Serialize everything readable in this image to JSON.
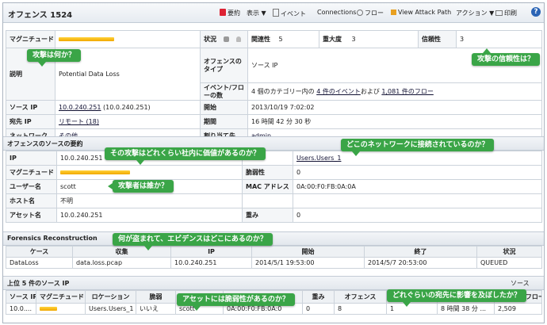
{
  "header": {
    "title": "オフェンス 1524",
    "toolbar": {
      "summary": "要約",
      "display": "表示 ▼",
      "events": "イベント",
      "connections": "Connections",
      "flows": "フロー",
      "attack_path": "View Attack Path",
      "actions": "アクション ▼",
      "print": "印刷",
      "help": "?"
    }
  },
  "offense": {
    "magnitude_label": "マグニチュード",
    "status_label": "状況",
    "relevance_label": "関連性",
    "relevance_value": "5",
    "severity_label": "重大度",
    "severity_value": "3",
    "credibility_label": "信頼性",
    "credibility_value": "3",
    "description_label": "説明",
    "description_value": "Potential Data Loss",
    "offense_type_label": "オフェンスのタイプ",
    "offense_type_value": "ソース IP",
    "event_flow_label": "イベント/フローの数",
    "event_flow_prefix": "4 個のカテゴリー内の ",
    "event_flow_events": "4 件のイベント",
    "event_flow_mid": "および ",
    "event_flow_flows": "1,081 件のフロー",
    "source_ip_label": "ソース IP",
    "source_ip_link": "10.0.240.251",
    "source_ip_extra": " (10.0.240.251)",
    "start_label": "開始",
    "start_value": "2013/10/19 7:02:02",
    "dest_ip_label": "宛先 IP",
    "dest_ip_value": "リモート (18)",
    "duration_label": "期間",
    "duration_value": "16 時間 42 分 30 秒",
    "network_label": "ネットワーク",
    "network_value": "その他",
    "assigned_label": "割り当て先",
    "assigned_value": "admin"
  },
  "source_summary": {
    "section_title": "オフェンスのソースの要約",
    "ip_label": "IP",
    "ip_value": "10.0.240.251",
    "network_value": "Users.Users_1",
    "magnitude_label": "マグニチュード",
    "vuln_label": "脆弱性",
    "vuln_value": "0",
    "user_label": "ユーザー名",
    "user_value": "scott",
    "mac_label": "MAC アドレス",
    "mac_value": "0A:00:F0:FB:0A:0A",
    "host_label": "ホスト名",
    "host_value": "不明",
    "asset_label": "アセット名",
    "asset_value": "10.0.240.251",
    "weight_label": "重み",
    "weight_value": "0"
  },
  "forensics": {
    "section_title": "Forensics Reconstruction",
    "columns": [
      "ケース",
      "収集",
      "IP",
      "開始",
      "終了",
      "状況"
    ],
    "rows": [
      [
        "DataLoss",
        "data.loss.pcap",
        "10.0.240.251",
        "2014/5/1 19:53:00",
        "2014/5/7 20:53:00",
        "QUEUED"
      ]
    ]
  },
  "top_sources": {
    "section_title": "上位 5 件のソース IP",
    "right_link": "ソース",
    "columns": [
      "ソース IP",
      "マグニチュード",
      "ロケーション",
      "脆弱",
      "ユーザー",
      "MAC",
      "重み",
      "オフェンス",
      "宛先",
      "最終観測",
      "イベント/フロー"
    ],
    "rows": [
      [
        "10.0....",
        "",
        "Users.Users_1",
        "いいえ",
        "scott",
        "0A:00:F0:FB:0A:0",
        "0",
        "8",
        "1",
        "8 時間 38 分 ...",
        "2,509"
      ]
    ]
  },
  "callouts": {
    "attack": "攻撃は何か？",
    "credibility": "攻撃の信頼性は？",
    "value": "その攻撃はどれくらい社内に価値があるのか？",
    "network": "どこのネットワークに接続されているのか？",
    "attacker": "攻撃者は誰か？",
    "stolen": "何が盗まれて、エビデンスはどこにあるのか？",
    "vulnerable": "アセットには脆弱性があるのか？",
    "impact": "どれぐらいの宛先に影響を及ぼしたか？"
  },
  "colors": {
    "callout_green": "#3aa547",
    "magnitude_bar": "#f5b800",
    "help_blue": "#2a64b5"
  }
}
